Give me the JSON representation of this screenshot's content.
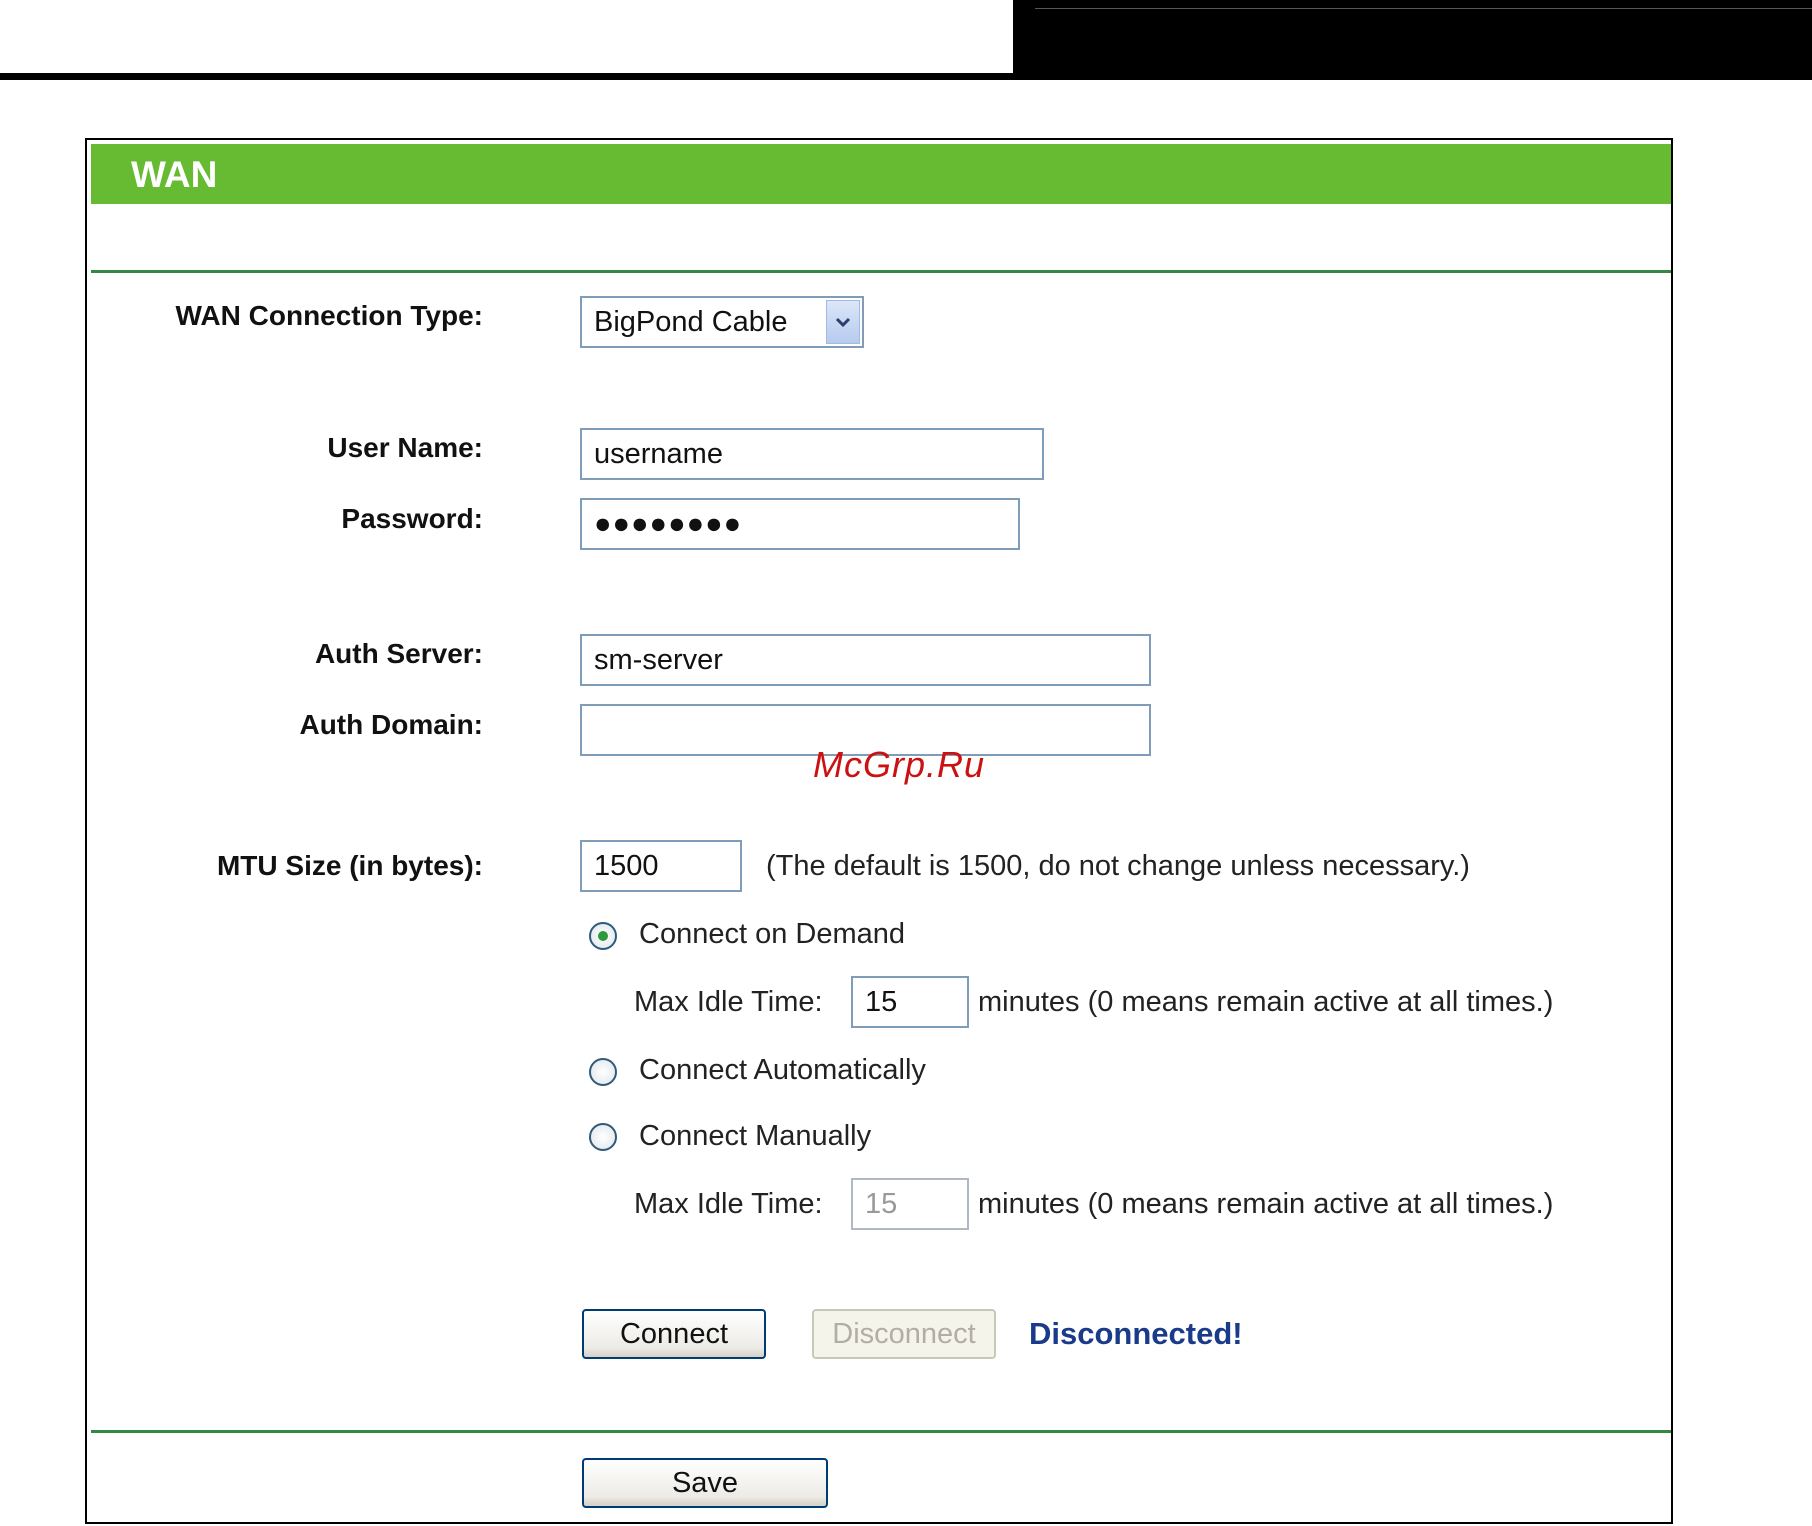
{
  "page": {
    "title": "WAN"
  },
  "form": {
    "connection_type": {
      "label": "WAN Connection Type:",
      "value": "BigPond Cable"
    },
    "user_name": {
      "label": "User Name:",
      "value": "username"
    },
    "password": {
      "label": "Password:",
      "value": "●●●●●●●●"
    },
    "auth_server": {
      "label": "Auth Server:",
      "value": "sm-server"
    },
    "auth_domain": {
      "label": "Auth Domain:",
      "value": ""
    },
    "mtu": {
      "label": "MTU Size (in bytes):",
      "value": "1500",
      "note": "(The default is 1500, do not change unless necessary.)"
    },
    "connect_on_demand": {
      "label": "Connect on Demand",
      "checked": true,
      "idle_label": "Max Idle Time:",
      "idle_value": "15",
      "idle_note": "minutes (0 means remain active at all times.)"
    },
    "connect_automatically": {
      "label": "Connect Automatically",
      "checked": false
    },
    "connect_manually": {
      "label": "Connect Manually",
      "checked": false,
      "idle_label": "Max Idle Time:",
      "idle_value": "15",
      "idle_note": "minutes (0 means remain active at all times.)"
    }
  },
  "actions": {
    "connect_label": "Connect",
    "disconnect_label": "Disconnect",
    "status": "Disconnected!",
    "save_label": "Save"
  },
  "watermark": "McGrp.Ru",
  "colors": {
    "title_bar": "#66bb33",
    "divider": "#338844",
    "status_text": "#1a3a8a",
    "watermark": "#cc1111"
  }
}
